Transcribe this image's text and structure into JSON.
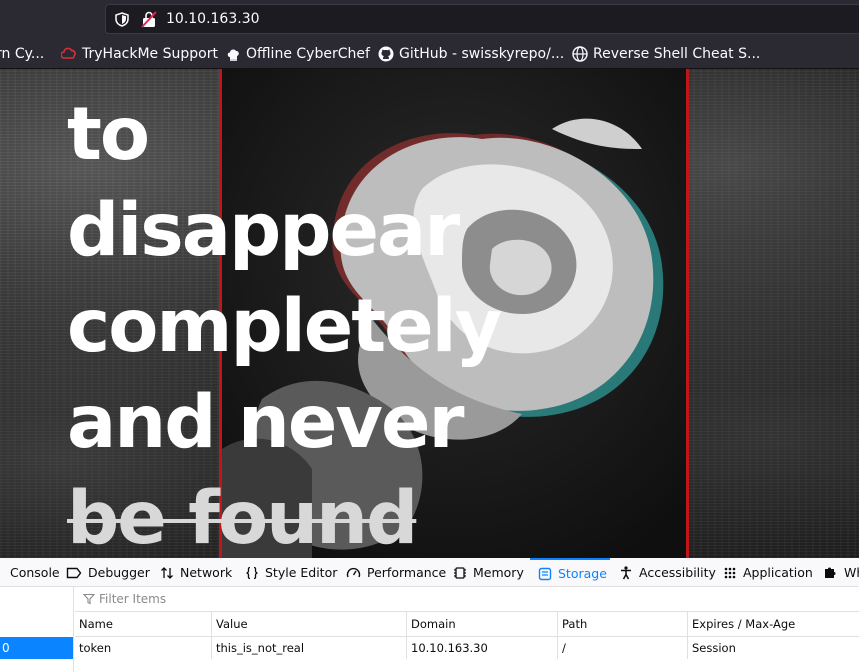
{
  "urlbar": {
    "url": "10.10.163.30",
    "shield_icon": "shield-icon",
    "insecure_icon": "insecure-lock-icon"
  },
  "bookmarks": [
    {
      "label": "rn Cy...",
      "icon": "none"
    },
    {
      "label": "TryHackMe Support",
      "icon": "tryhackme-icon"
    },
    {
      "label": "Offline CyberChef",
      "icon": "chef-hat-icon"
    },
    {
      "label": "GitHub - swisskyrepo/...",
      "icon": "github-icon"
    },
    {
      "label": "Reverse Shell Cheat S...",
      "icon": "globe-icon"
    }
  ],
  "page": {
    "headline": [
      "to",
      "disappear",
      "completely",
      "and never",
      "be found"
    ],
    "accent_color": "#c0161a"
  },
  "devtools": {
    "tabs": [
      {
        "label": "Console",
        "icon": "console-icon"
      },
      {
        "label": "Debugger",
        "icon": "debugger-icon"
      },
      {
        "label": "Network",
        "icon": "network-icon"
      },
      {
        "label": "Style Editor",
        "icon": "braces-icon"
      },
      {
        "label": "Performance",
        "icon": "gauge-icon"
      },
      {
        "label": "Memory",
        "icon": "memory-chip-icon"
      },
      {
        "label": "Storage",
        "icon": "storage-icon",
        "active": true
      },
      {
        "label": "Accessibility",
        "icon": "accessibility-icon"
      },
      {
        "label": "Application",
        "icon": "grid-icon"
      },
      {
        "label": "Wh",
        "icon": "puzzle-icon"
      }
    ],
    "sidebar_selected": "0",
    "filter_placeholder": "Filter Items",
    "columns": [
      "Name",
      "Value",
      "Domain",
      "Path",
      "Expires / Max-Age"
    ],
    "rows": [
      {
        "name": "token",
        "value": "this_is_not_real",
        "domain": "10.10.163.30",
        "path": "/",
        "expires": "Session"
      }
    ],
    "active_color": "#0a84ff"
  }
}
